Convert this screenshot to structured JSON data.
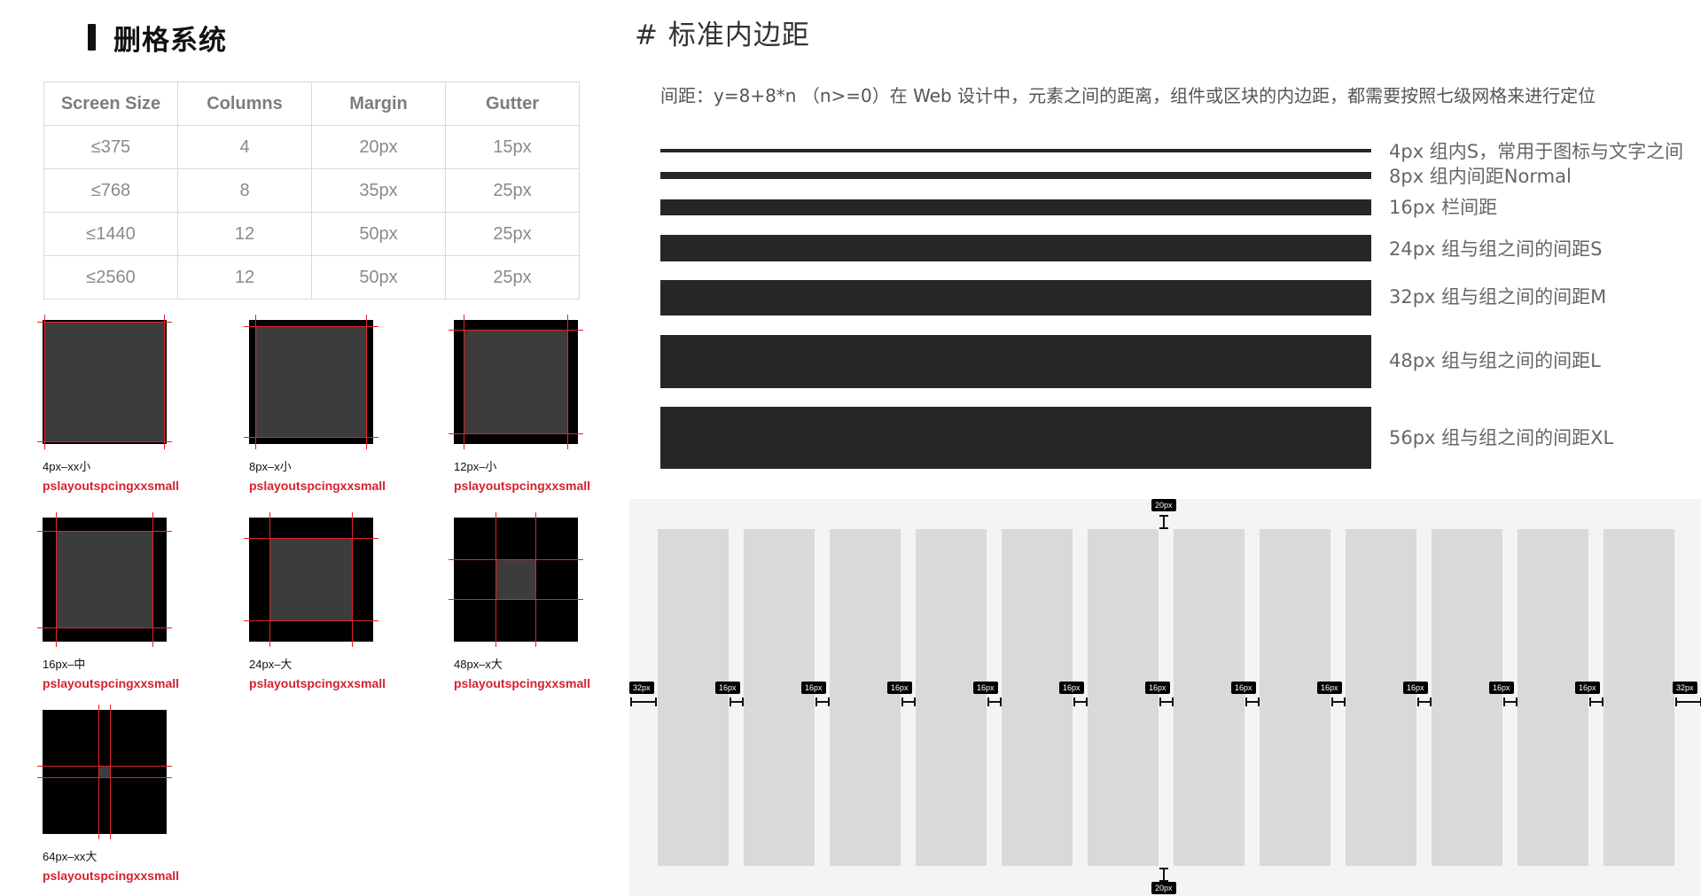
{
  "grid_section": {
    "title": "删格系统",
    "table": {
      "headers": [
        "Screen Size",
        "Columns",
        "Margin",
        "Gutter"
      ],
      "rows": [
        [
          "≤375",
          "4",
          "20px",
          "15px"
        ],
        [
          "≤768",
          "8",
          "35px",
          "25px"
        ],
        [
          "≤1440",
          "12",
          "50px",
          "25px"
        ],
        [
          "≤2560",
          "12",
          "50px",
          "25px"
        ]
      ]
    },
    "spacing_tokens": [
      {
        "name": "4px–xx小",
        "token": "pslayoutspcingxxsmall"
      },
      {
        "name": "8px–x小",
        "token": "pslayoutspcingxxsmall"
      },
      {
        "name": "12px–小",
        "token": "pslayoutspcingxxsmall"
      },
      {
        "name": "16px–中",
        "token": "pslayoutspcingxxsmall"
      },
      {
        "name": "24px–大",
        "token": "pslayoutspcingxxsmall"
      },
      {
        "name": "48px–x大",
        "token": "pslayoutspcingxxsmall"
      },
      {
        "name": "64px–xx大",
        "token": "pslayoutspcingxxsmall"
      }
    ]
  },
  "padding_section": {
    "title": "# 标准内边距",
    "description": "间距：y=8+8*n （n>=0）在 Web 设计中，元素之间的距离，组件或区块的内边距，都需要按照七级网格来进行定位",
    "levels": [
      {
        "label": "4px   组内S，常用于图标与文字之间"
      },
      {
        "label": "8px   组内间距Normal"
      },
      {
        "label": "16px 栏间距"
      },
      {
        "label": "24px 组与组之间的间距S"
      },
      {
        "label": "32px 组与组之间的间距M"
      },
      {
        "label": "48px 组与组之间的间距L"
      },
      {
        "label": "56px 组与组之间的间距XL"
      }
    ]
  },
  "column_demo": {
    "top_margin_label": "20px",
    "bottom_margin_label": "20px",
    "outer_margin_label": "32px",
    "gutter_label": "16px",
    "column_count": 12
  },
  "colors": {
    "guide_line": "#e0232a",
    "token_text": "#d4232c",
    "bar": "#262626"
  }
}
